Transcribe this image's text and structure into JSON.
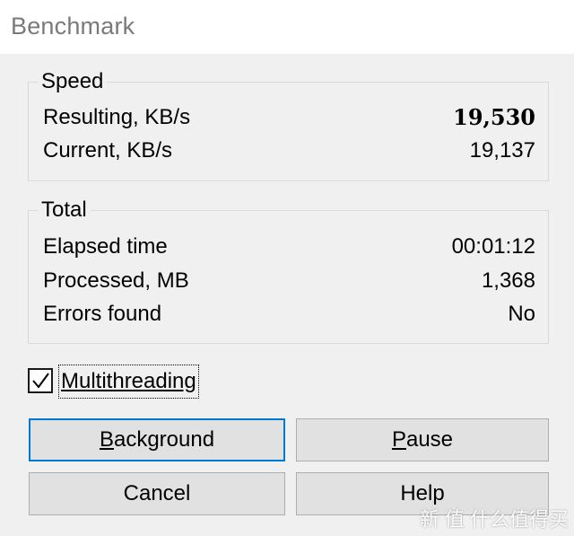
{
  "window": {
    "title": "Benchmark"
  },
  "speed": {
    "label": "Speed",
    "rows": [
      {
        "label": "Resulting, KB/s",
        "value": "19,530"
      },
      {
        "label": "Current, KB/s",
        "value": "19,137"
      }
    ]
  },
  "total": {
    "label": "Total",
    "rows": [
      {
        "label": "Elapsed time",
        "value": "00:01:12"
      },
      {
        "label": "Processed, MB",
        "value": "1,368"
      },
      {
        "label": "Errors found",
        "value": "No"
      }
    ]
  },
  "multithreading": {
    "label": "Multithreading",
    "checked": true
  },
  "buttons": {
    "background": {
      "label": "Background",
      "mnemonic": "B",
      "rest": "ackground"
    },
    "pause": {
      "label": "Pause",
      "mnemonic": "P",
      "rest": "ause"
    },
    "cancel": {
      "label": "Cancel"
    },
    "help": {
      "label": "Help"
    }
  },
  "watermark": {
    "text": "新 值 什么值得买"
  },
  "colors": {
    "accent": "#0078d7",
    "background": "#f0f0f0",
    "title": "#7a7a7a"
  }
}
